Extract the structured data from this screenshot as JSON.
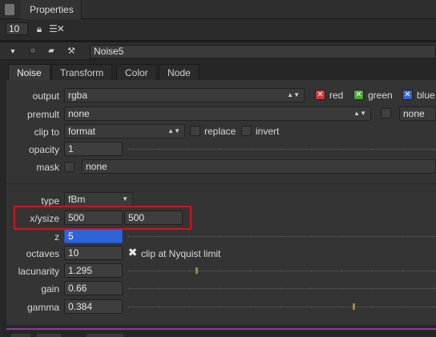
{
  "titlebar": {
    "tab_label": "Properties"
  },
  "toolbar": {
    "max_panels_value": "10",
    "lock_icon": "lock-icon",
    "clear_icon": "clear-panels-icon"
  },
  "node": {
    "name": "Noise5",
    "icons": [
      "collapse-arrow-icon",
      "circle-icon",
      "camera-icon",
      "tools-icon"
    ]
  },
  "tabs": [
    {
      "label": "Noise",
      "active": true
    },
    {
      "label": "Transform",
      "active": false
    },
    {
      "label": "Color",
      "active": false
    },
    {
      "label": "Node",
      "active": false
    }
  ],
  "params": {
    "output": {
      "label": "output",
      "value": "rgba",
      "channels": [
        "red",
        "green",
        "blue"
      ]
    },
    "premult": {
      "label": "premult",
      "value": "none",
      "extra_value": "none"
    },
    "clip_to": {
      "label": "clip to",
      "value": "format",
      "replace_label": "replace",
      "invert_label": "invert"
    },
    "opacity": {
      "label": "opacity",
      "value": "1"
    },
    "mask": {
      "label": "mask",
      "value": "none"
    },
    "type": {
      "label": "type",
      "value": "fBm"
    },
    "xysize": {
      "label": "x/ysize",
      "x": "500",
      "y": "500"
    },
    "z": {
      "label": "z",
      "value": "5"
    },
    "octaves": {
      "label": "octaves",
      "value": "10",
      "nyquist_label": "clip at Nyquist limit"
    },
    "lacunarity": {
      "label": "lacunarity",
      "value": "1.295",
      "slider_level": 0.22
    },
    "gain": {
      "label": "gain",
      "value": "0.66"
    },
    "gamma": {
      "label": "gamma",
      "value": "0.384",
      "slider_level": 0.73
    }
  },
  "colors": {
    "highlight": "#d0141c",
    "selected_field": "#2f64d8",
    "node_bar": "#8b3f98"
  }
}
